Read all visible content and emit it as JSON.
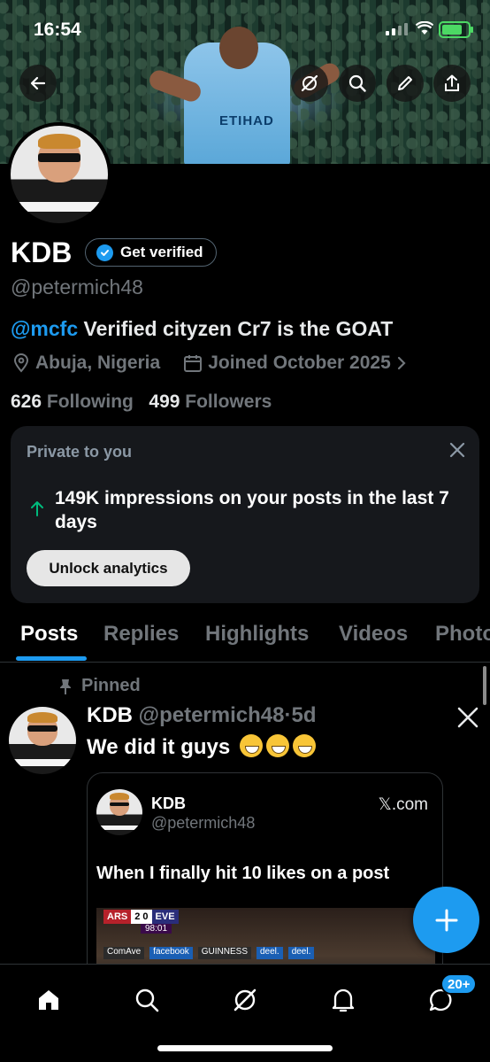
{
  "status_bar": {
    "time": "16:54"
  },
  "profile": {
    "name": "KDB",
    "verify_label": "Get verified",
    "handle": "@petermich48",
    "bio_mention": "@mcfc",
    "bio_text": " Verified cityzen Cr7 is the GOAT",
    "location": "Abuja, Nigeria",
    "joined": "Joined October 2025",
    "following_count": "626",
    "following_label": "Following",
    "followers_count": "499",
    "followers_label": "Followers",
    "banner_sponsor": "ETIHAD"
  },
  "private_card": {
    "title": "Private to you",
    "message": "149K impressions on your posts in the last 7 days",
    "button_label": "Unlock analytics"
  },
  "tabs": [
    "Posts",
    "Replies",
    "Highlights",
    "Videos",
    "Photo"
  ],
  "active_tab": "Posts",
  "post": {
    "pinned_label": "Pinned",
    "author": "KDB",
    "handle": "@petermich48",
    "dot": "·",
    "time": "5d",
    "text": "We did it guys",
    "quote": {
      "author": "KDB",
      "handle": "@petermich48",
      "domain": "𝕏.com",
      "text": "When I finally hit 10 likes on a post",
      "media": {
        "team_home": "ARS",
        "score": "2  0",
        "team_away": "EVE",
        "clock": "98:01",
        "ads": [
          "ComAve",
          "facebook",
          "GUINNESS",
          "deel.",
          "deel."
        ]
      }
    }
  },
  "bottom_nav": {
    "notifications_badge": "20+",
    "items": [
      "home-icon",
      "search-icon",
      "grok-icon",
      "notifications-icon",
      "messages-icon"
    ]
  },
  "colors": {
    "accent": "#1d9bf0",
    "bg": "#000000",
    "muted": "#71767b"
  }
}
